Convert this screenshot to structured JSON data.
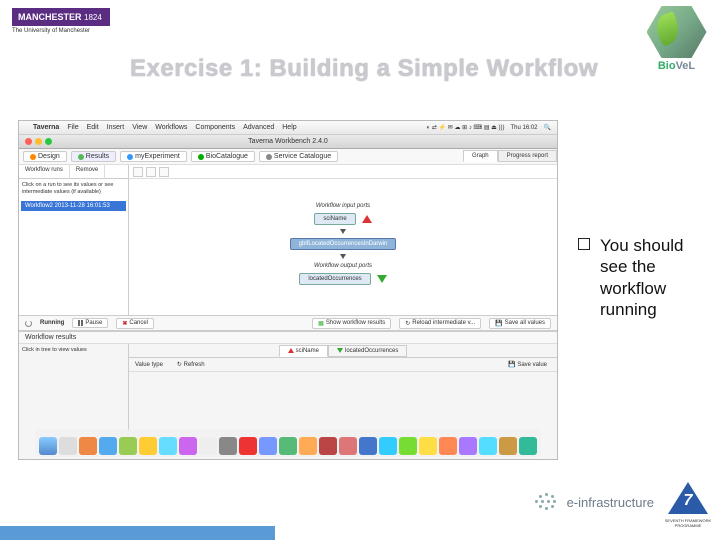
{
  "header": {
    "manchester": {
      "name": "MANCHESTER",
      "year": "1824",
      "sub": "The University of Manchester"
    },
    "biovel": {
      "b": "Bio",
      "v": "VeL"
    },
    "title": "Exercise 1: Building a Simple Workflow"
  },
  "screenshot": {
    "mac_menu": {
      "app": "Taverna",
      "items": [
        "File",
        "Edit",
        "Insert",
        "View",
        "Workflows",
        "Components",
        "Advanced",
        "Help"
      ],
      "clock": "Thu 16:02"
    },
    "titlebar": "Taverna Workbench 2.4.0",
    "perspectives": {
      "design": "Design",
      "results": "Results",
      "my": "myExperiment",
      "biocat": "BioCatalogue",
      "svc": "Service Catalogue"
    },
    "left_panel": {
      "tab1": "Workflow runs",
      "tab2": "Remove",
      "help": "Click on a run to see its values or see intermediate values (if available)",
      "run": "Workflow2 2013-11-28 16:01:53"
    },
    "graph": {
      "tab_graph": "Graph",
      "tab_progress": "Progress report",
      "input_ports": "Workflow input ports",
      "input_node": "sciName",
      "proc_node": "gbifLocatedOccurrencesInDarwin",
      "output_ports": "Workflow output ports",
      "output_node": "locatedOccurrences"
    },
    "mid_bar": {
      "running": "Running",
      "pause": "Pause",
      "cancel": "Cancel",
      "show": "Show workflow results",
      "reload": "Reload intermediate v...",
      "save": "Save all values"
    },
    "results": {
      "header": "Workflow results",
      "left_help": "Click in tree to   view values",
      "tab_in": "sciName",
      "tab_out": "locatedOccurrences",
      "value_type": "Value type",
      "refresh": "Refresh",
      "save_value": "Save value"
    }
  },
  "bullet": "You should see the workflow running",
  "footer": {
    "einfra": "e-infrastructure",
    "fp7_num": "7",
    "fp7_txt": "SEVENTH FRAMEWORK PROGRAMME"
  }
}
